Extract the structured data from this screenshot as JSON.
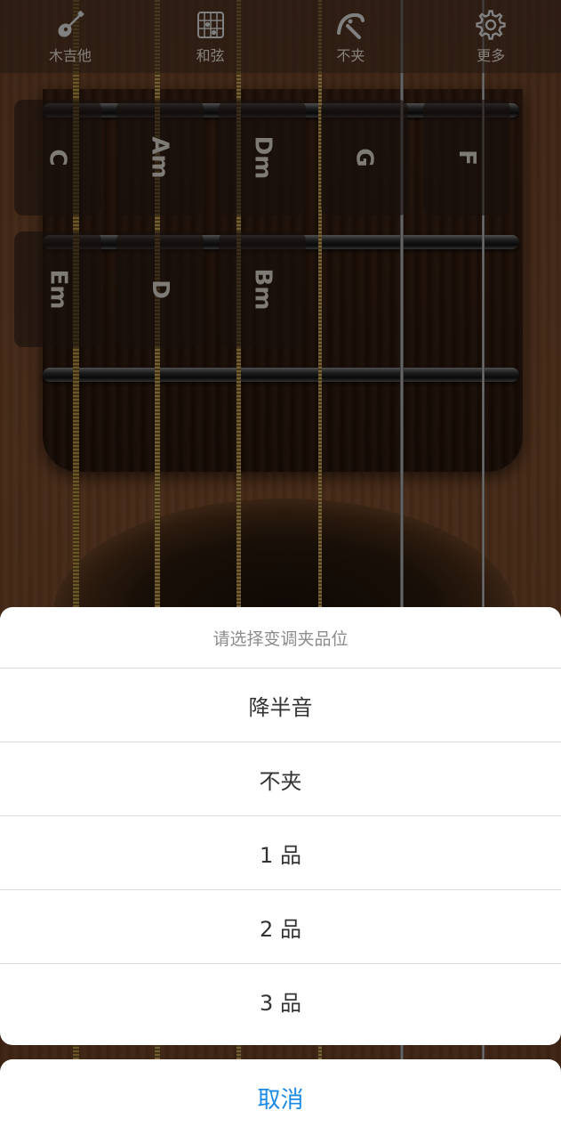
{
  "toolbar": {
    "items": [
      {
        "label": "木吉他",
        "icon": "guitar-icon"
      },
      {
        "label": "和弦",
        "icon": "chord-grid-icon"
      },
      {
        "label": "不夹",
        "icon": "capo-icon"
      },
      {
        "label": "更多",
        "icon": "gear-icon"
      }
    ]
  },
  "chords": {
    "row1": [
      "C",
      "Am",
      "Dm",
      "G",
      "F"
    ],
    "row2": [
      "Em",
      "D",
      "Bm"
    ]
  },
  "sheet": {
    "title": "请选择变调夹品位",
    "options": [
      "降半音",
      "不夹",
      "1 品",
      "2 品",
      "3 品"
    ],
    "cancel_label": "取消"
  },
  "colors": {
    "accent": "#1a8ae5",
    "sheet_title": "#8c8c8c",
    "option_text": "#333333"
  }
}
